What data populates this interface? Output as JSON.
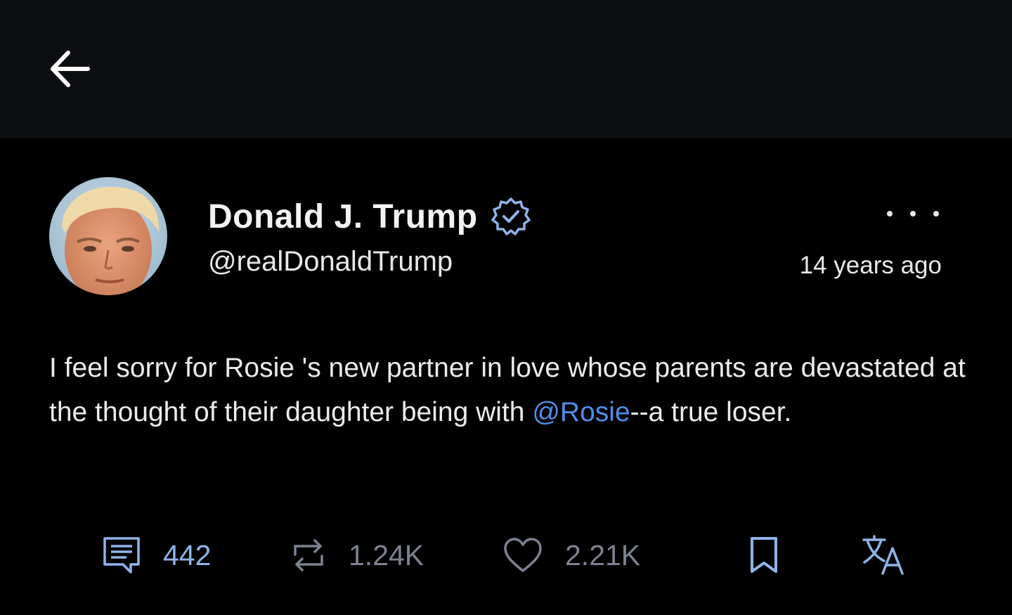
{
  "header": {
    "back_icon": "arrow-left-icon"
  },
  "post": {
    "author_name": "Donald J. Trump",
    "verified_icon": "verified-badge-icon",
    "handle": "@realDonaldTrump",
    "timestamp": "14 years ago",
    "more_icon": "more-options-icon",
    "text_part1": "I feel sorry for Rosie 's new partner in love whose parents are devastated at the thought of their daughter being with ",
    "mention": "@Rosie",
    "text_part2": "--a true loser."
  },
  "stats": {
    "replies": "442",
    "reposts": "1.24K",
    "likes": "2.21K"
  },
  "colors": {
    "background": "#000000",
    "header_background": "#0d0e11",
    "accent": "#4f8ee8",
    "muted": "#7c8291"
  }
}
